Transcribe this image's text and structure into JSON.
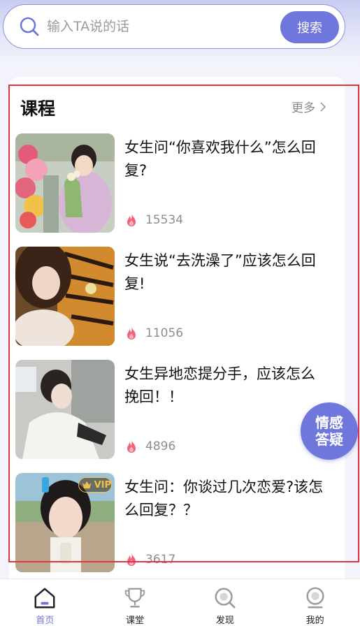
{
  "search": {
    "placeholder": "输入TA说的话",
    "button_label": "搜索"
  },
  "section": {
    "title": "课程",
    "more_label": "更多"
  },
  "courses": [
    {
      "title": "女生问“你喜欢我什么”怎么回复?",
      "views": "15534",
      "vip": false
    },
    {
      "title": "女生说“去洗澡了”应该怎么回复!",
      "views": "11056",
      "vip": false
    },
    {
      "title": "女生异地恋提分手，应该怎么挽回！！",
      "views": "4896",
      "vip": false
    },
    {
      "title": "女生问：你谈过几次恋爱?该怎么回复？？",
      "views": "3617",
      "vip": true,
      "vip_label": "VIP"
    }
  ],
  "float_button": {
    "line1": "情感",
    "line2": "答疑"
  },
  "tabs": [
    {
      "label": "首页",
      "icon": "home-icon",
      "active": true
    },
    {
      "label": "课堂",
      "icon": "trophy-icon",
      "active": false
    },
    {
      "label": "发现",
      "icon": "discover-icon",
      "active": false
    },
    {
      "label": "我的",
      "icon": "profile-icon",
      "active": false
    }
  ],
  "colors": {
    "accent": "#6f76dc",
    "highlight_border": "#e2353d",
    "fire": "#f2607a"
  }
}
